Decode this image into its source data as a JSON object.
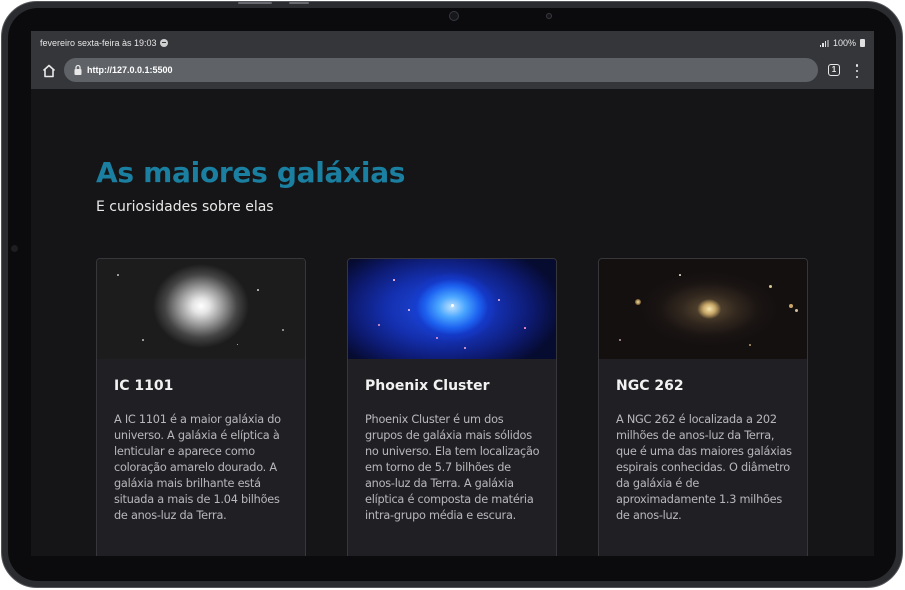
{
  "status_bar": {
    "left_text": "fevereiro sexta-feira às 19:03",
    "battery": "100%"
  },
  "browser": {
    "url": "http://127.0.0.1:5500",
    "tab_count": "1"
  },
  "page": {
    "title": "As maiores galáxias",
    "subtitle": "E curiosidades sobre elas",
    "accent_color": "#1a7fa0",
    "cards": [
      {
        "title": "IC 1101",
        "image_icon": "elliptical-galaxy-image",
        "text": "A IC 1101 é a maior galáxia do universo. A galáxia é elíptica à lenticular e aparece como coloração amarelo dourado. A galáxia mais brilhante está situada a mais de 1.04 bilhões de anos-luz da Terra."
      },
      {
        "title": "Phoenix Cluster",
        "image_icon": "galaxy-cluster-image",
        "text": "Phoenix Cluster é um dos grupos de galáxia mais sólidos no universo. Ela tem localização em torno de 5.7 bilhões de anos-luz da Terra. A galáxia elíptica é composta de matéria intra-grupo média e escura."
      },
      {
        "title": "NGC 262",
        "image_icon": "spiral-galaxy-image",
        "text": "A NGC 262 é localizada a 202 milhões de anos-luz da Terra, que é uma das maiores galáxias espirais conhecidas. O diâmetro da galáxia é de aproximadamente 1.3 milhões de anos-luz."
      }
    ]
  }
}
